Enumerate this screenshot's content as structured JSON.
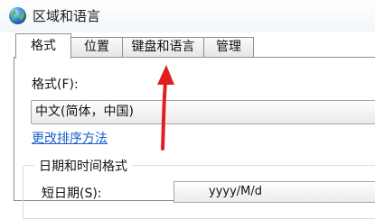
{
  "window": {
    "title": "区域和语言",
    "icon": "globe-icon"
  },
  "tabs": [
    {
      "label": "格式",
      "active": true
    },
    {
      "label": "位置",
      "active": false
    },
    {
      "label": "键盘和语言",
      "active": false
    },
    {
      "label": "管理",
      "active": false
    }
  ],
  "format": {
    "label": "格式(F):",
    "selected": "中文(简体，中国)",
    "change_sort_link": "更改排序方法"
  },
  "datetime_group": {
    "title": "日期和时间格式",
    "short_date_label": "短日期(S):",
    "short_date_value": "yyyy/M/d"
  },
  "annotation": {
    "color": "#e02020"
  }
}
